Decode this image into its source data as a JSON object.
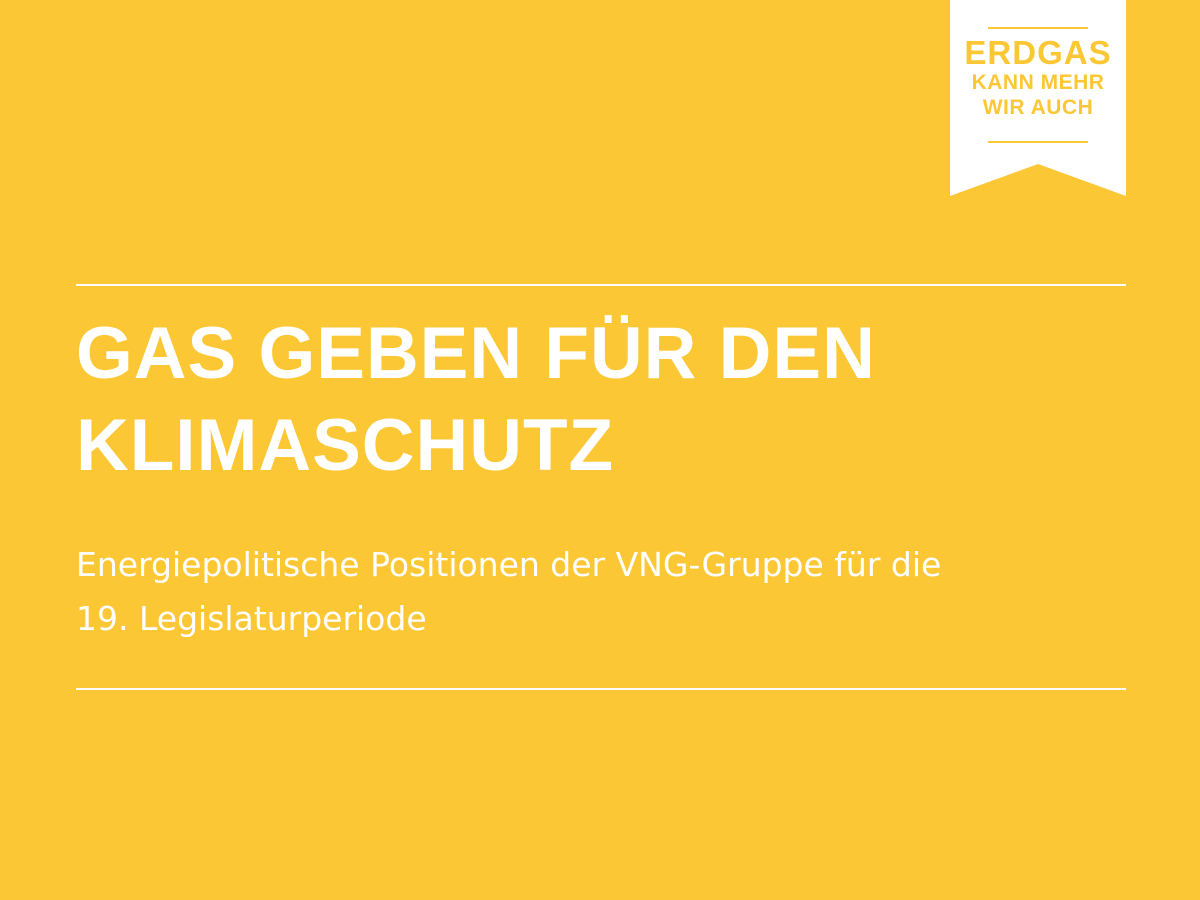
{
  "badge": {
    "line1": "ERDGAS",
    "line2": "KANN MEHR",
    "line3": "WIR AUCH"
  },
  "headline": {
    "line1": "GAS GEBEN FÜR DEN",
    "line2": "KLIMASCHUTZ"
  },
  "subtitle": {
    "line1": "Energiepolitische Positionen der VNG-Gruppe für die",
    "line2": "19. Legislaturperiode"
  },
  "colors": {
    "background": "#fcc734",
    "foreground": "#ffffff"
  }
}
